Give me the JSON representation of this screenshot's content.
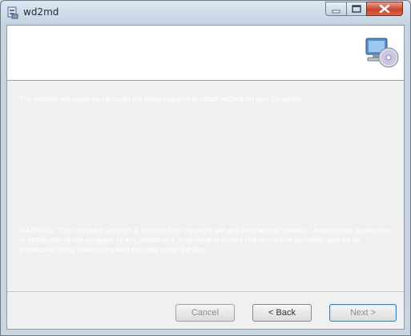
{
  "window": {
    "title": "wd2md",
    "controls": {
      "minimize": "minimize-icon",
      "maximize": "maximize-icon",
      "close": "close-icon"
    }
  },
  "banner": {
    "icon": "computer-cd-icon"
  },
  "text": {
    "intro": "The installer will guide you through the steps required to install wd2md on your computer.",
    "warning": "WARNING: This computer program is protected by copyright law and international treaties. Unauthorized duplication or distribution of this program, or any portion of it, may result in severe civil or criminal penalties, and will be prosecuted to the maximum extent possible under the law."
  },
  "buttons": {
    "cancel": "Cancel",
    "back": "< Back",
    "next": "Next >"
  },
  "colors": {
    "client_bg": "#f0f0f0",
    "banner_bg": "#ffffff",
    "close_red": "#c7452b"
  }
}
